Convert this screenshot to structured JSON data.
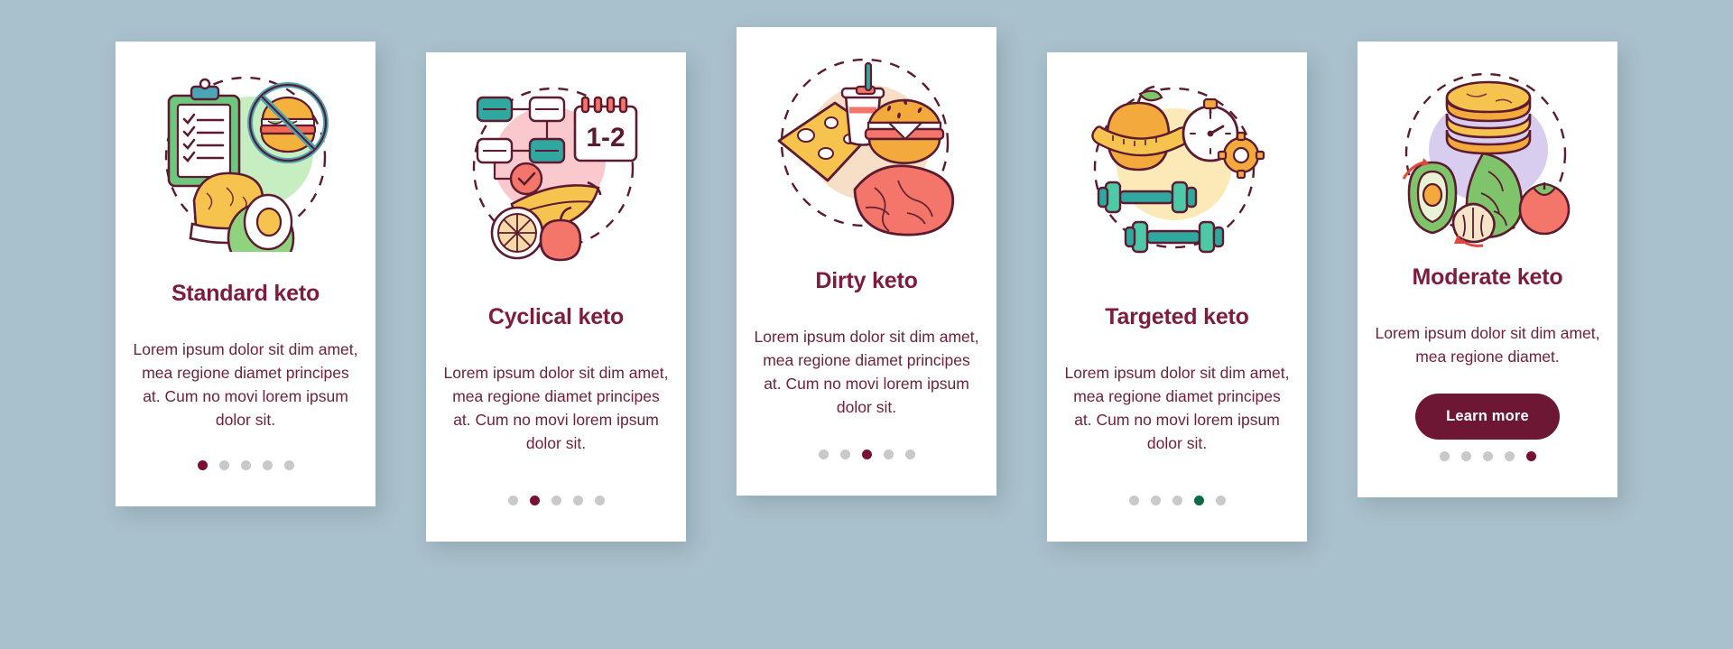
{
  "background_color": "#a9c1cc",
  "theme": {
    "title_color": "#7d1c3c",
    "text_color": "#6f2239",
    "button_bg": "#6d1734",
    "button_text": "#ffffff",
    "dot_inactive": "#c9c9c9",
    "dot_active_maroon": "#7a0f33",
    "dot_active_green": "#0b6b43",
    "card_bg": "#ffffff"
  },
  "cards": [
    {
      "id": "standard-keto",
      "illustration": "clipboard-checklist-no-burger-avocado-bread",
      "title": "Standard keto",
      "description": "Lorem ipsum dolor sit dim amet, mea regione diamet principes at. Cum no movi lorem ipsum dolor sit.",
      "has_button": false,
      "button_label": "",
      "dots": [
        "active-maroon",
        "inactive",
        "inactive",
        "inactive",
        "inactive"
      ],
      "blob_color": "#c6eec0"
    },
    {
      "id": "cyclical-keto",
      "illustration": "flowchart-calendar-banana-apple-grapefruit",
      "title": "Cyclical keto",
      "description": "Lorem ipsum dolor sit dim amet, mea regione diamet principes at. Cum no movi lorem ipsum dolor sit.",
      "has_button": false,
      "button_label": "",
      "dots": [
        "inactive",
        "active-maroon",
        "inactive",
        "inactive",
        "inactive"
      ],
      "blob_color": "#f9c9cd",
      "calendar_label": "1-2"
    },
    {
      "id": "dirty-keto",
      "illustration": "cheese-soda-burger-steak",
      "title": "Dirty keto",
      "description": "Lorem ipsum dolor sit dim amet, mea regione diamet principes at. Cum no movi lorem ipsum dolor sit.",
      "has_button": false,
      "button_label": "",
      "dots": [
        "inactive",
        "inactive",
        "active-maroon",
        "inactive",
        "inactive"
      ],
      "blob_color": "#f6dfc6"
    },
    {
      "id": "targeted-keto",
      "illustration": "apple-measuring-tape-stopwatch-gear-dumbbells",
      "title": "Targeted keto",
      "description": "Lorem ipsum dolor sit dim amet, mea regione diamet principes at. Cum no movi lorem ipsum dolor sit.",
      "has_button": false,
      "button_label": "",
      "dots": [
        "inactive",
        "inactive",
        "inactive",
        "active-green",
        "inactive"
      ],
      "blob_color": "#fbe9b8"
    },
    {
      "id": "moderate-keto",
      "illustration": "pancakes-avocado-cucumber-tomato-garlic",
      "title": "Moderate keto",
      "description": "Lorem ipsum dolor sit dim amet, mea regione diamet.",
      "has_button": true,
      "button_label": "Learn more",
      "dots": [
        "inactive",
        "inactive",
        "inactive",
        "inactive",
        "active-maroon"
      ],
      "blob_color": "#d8cdee"
    }
  ]
}
